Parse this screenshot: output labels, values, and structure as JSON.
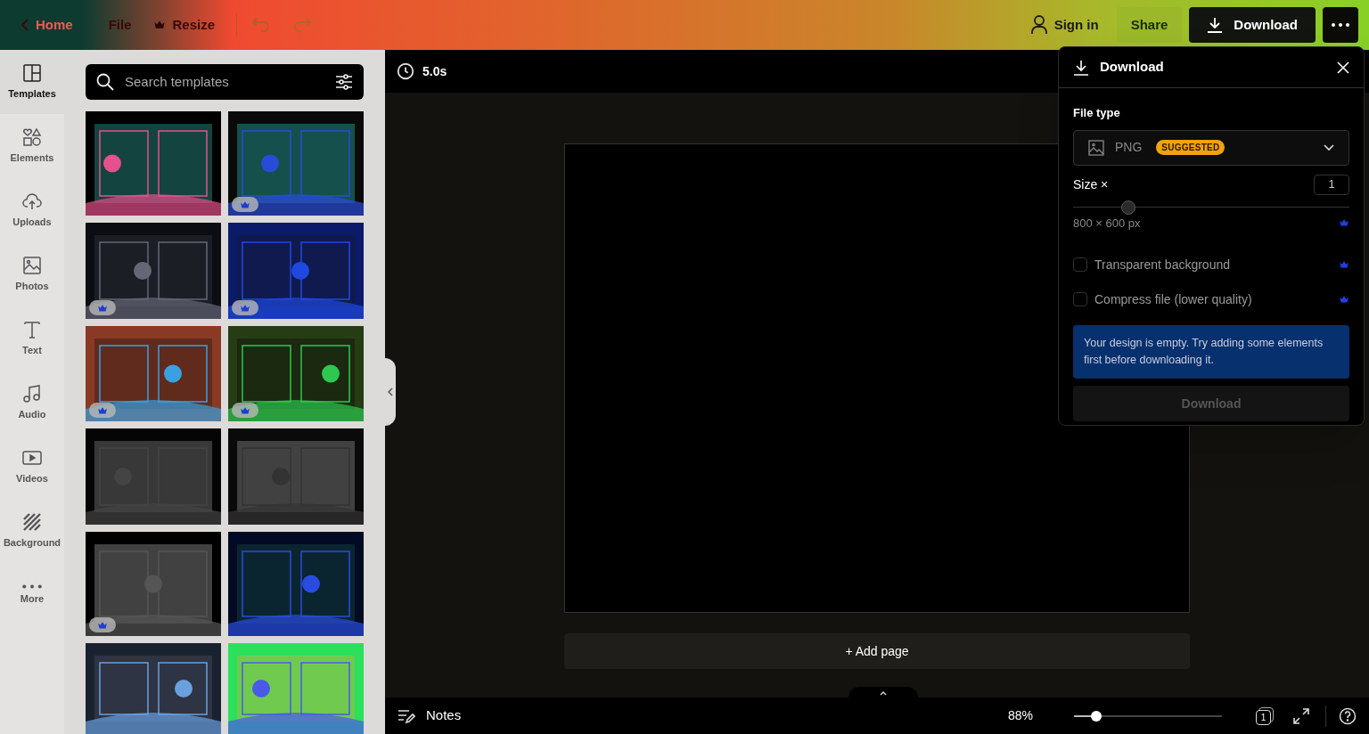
{
  "top_bar": {
    "nav": [
      {
        "kind": "back",
        "label": "Home"
      },
      {
        "kind": "plain",
        "label": "File"
      },
      {
        "kind": "premium",
        "label": "Resize"
      }
    ],
    "sign_in": "Sign in",
    "share": "Share",
    "download": "Download"
  },
  "side_rail": {
    "items": [
      {
        "kind": "templates",
        "label": "Templates",
        "selected": true
      },
      {
        "kind": "elements",
        "label": "Elements",
        "selected": false
      },
      {
        "kind": "uploads",
        "label": "Uploads",
        "selected": false
      },
      {
        "kind": "photos",
        "label": "Photos",
        "selected": false
      },
      {
        "kind": "text",
        "label": "Text",
        "selected": false
      },
      {
        "kind": "audio",
        "label": "Audio",
        "selected": false
      },
      {
        "kind": "videos",
        "label": "Videos",
        "selected": false
      },
      {
        "kind": "background",
        "label": "Background",
        "selected": false
      },
      {
        "kind": "more",
        "label": "More",
        "selected": false
      }
    ]
  },
  "templates_panel": {
    "search": {
      "placeholder": "Search templates"
    },
    "templates": [
      {
        "premium": false
      },
      {
        "premium": true
      },
      {
        "premium": true
      },
      {
        "premium": true
      },
      {
        "premium": true
      },
      {
        "premium": true
      },
      {
        "premium": false
      },
      {
        "premium": false
      },
      {
        "premium": true
      },
      {
        "premium": false
      },
      {
        "premium": false
      },
      {
        "premium": false
      }
    ]
  },
  "canvas": {
    "duration": "5.0s",
    "add_page": "+ Add page"
  },
  "bottom_bar": {
    "notes": "Notes",
    "zoom": "88%",
    "zoom_slider": {
      "level": 0.15
    },
    "page_count": "1"
  },
  "download_panel": {
    "title": "Download",
    "file_type_label": "File type",
    "file_type": "PNG",
    "badge": "SUGGESTED",
    "size_label": "Size ×",
    "size_value": "1",
    "size_slider": {
      "level": 0.2
    },
    "dimensions": "800 × 600 px",
    "dimensions_premium": true,
    "options": [
      {
        "label": "Transparent background",
        "checked": false,
        "premium": true
      },
      {
        "label": "Compress file (lower quality)",
        "checked": false,
        "premium": true
      }
    ],
    "notice": "Your design is empty. Try adding some elements first before downloading it.",
    "download_button": {
      "label": "Download",
      "disabled": true
    }
  }
}
